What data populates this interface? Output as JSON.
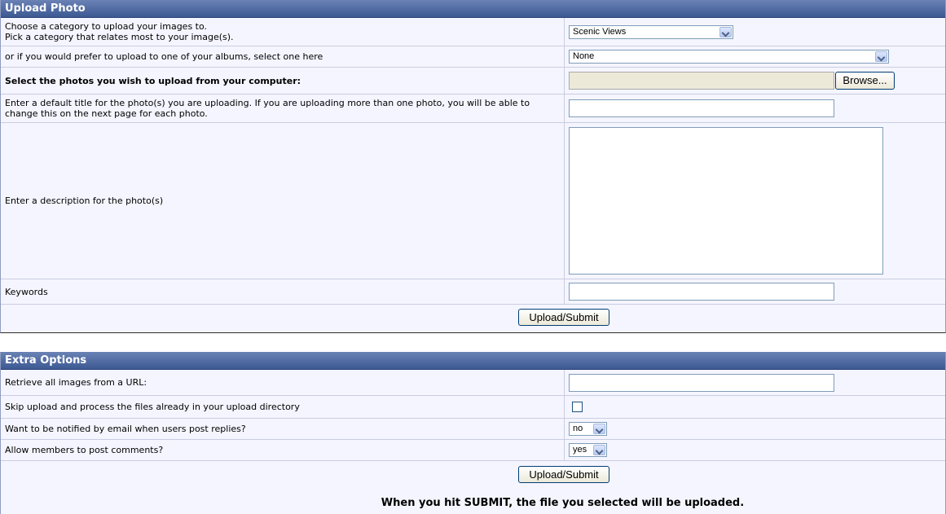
{
  "upload": {
    "header": "Upload Photo",
    "category_label_1": "Choose a category to upload your images to.",
    "category_label_2": "Pick a category that relates most to your image(s).",
    "category_value": "Scenic Views",
    "album_label": "or if you would prefer to upload to one of your albums, select one here",
    "album_value": "None",
    "file_label": "Select the photos you wish to upload from your computer:",
    "browse_label": "Browse...",
    "title_label": "Enter a default title for the photo(s) you are uploading. If you are uploading more than one photo, you will be able to change this on the next page for each photo.",
    "description_label": "Enter a description for the photo(s)",
    "keywords_label": "Keywords",
    "submit_label": "Upload/Submit"
  },
  "extra": {
    "header": "Extra Options",
    "url_label": "Retrieve all images from a URL:",
    "skip_label": "Skip upload and process the files already in your upload directory",
    "notify_label": "Want to be notified by email when users post replies?",
    "notify_value": "no",
    "comments_label": "Allow members to post comments?",
    "comments_value": "yes",
    "submit_label": "Upload/Submit",
    "note": "When you hit SUBMIT, the file you selected will be uploaded."
  }
}
